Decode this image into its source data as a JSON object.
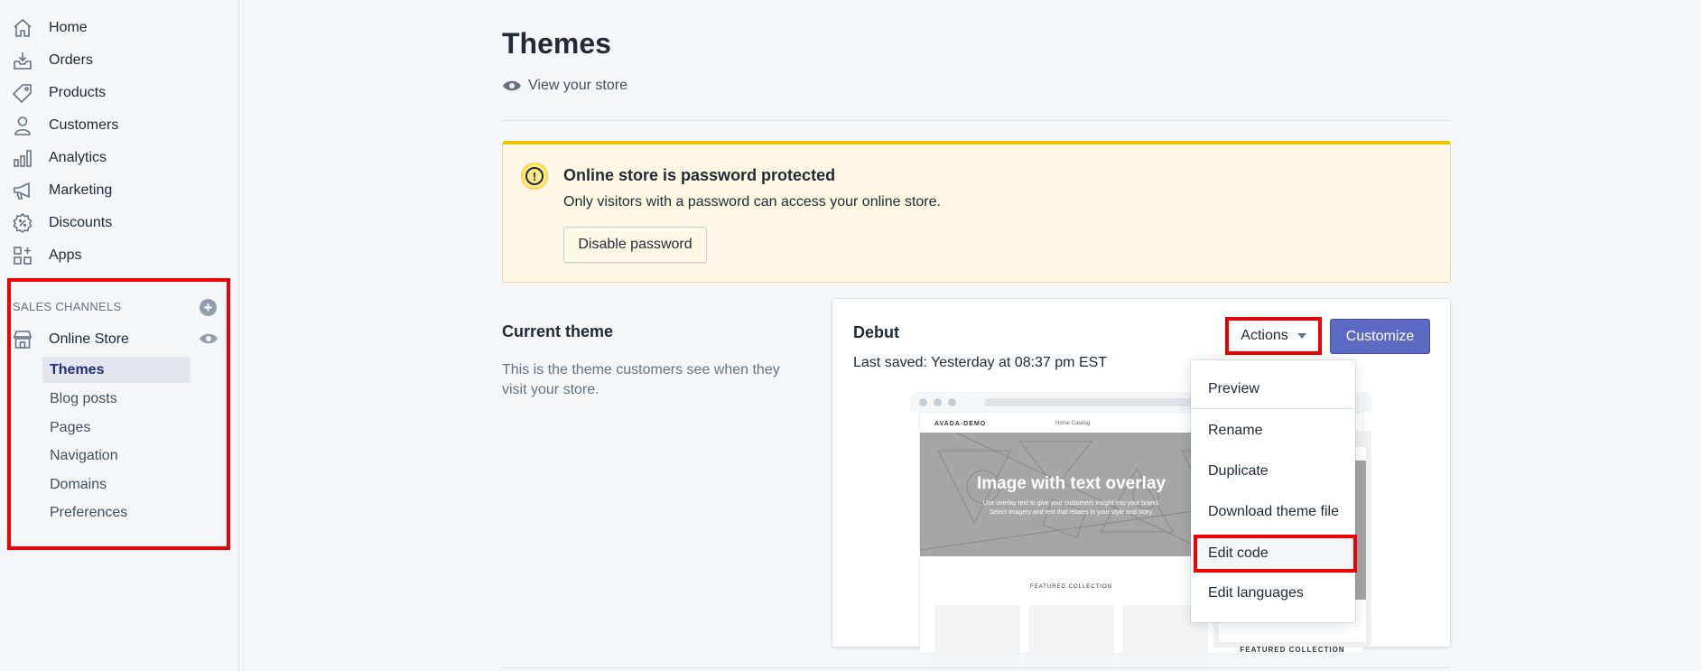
{
  "sidebar": {
    "items": [
      {
        "label": "Home",
        "icon": "home-icon"
      },
      {
        "label": "Orders",
        "icon": "orders-icon"
      },
      {
        "label": "Products",
        "icon": "tag-icon"
      },
      {
        "label": "Customers",
        "icon": "person-icon"
      },
      {
        "label": "Analytics",
        "icon": "bar-chart-icon"
      },
      {
        "label": "Marketing",
        "icon": "megaphone-icon"
      },
      {
        "label": "Discounts",
        "icon": "discount-icon"
      },
      {
        "label": "Apps",
        "icon": "apps-icon"
      }
    ],
    "sales_channels": {
      "title": "SALES CHANNELS",
      "add_symbol": "+",
      "online_store": {
        "label": "Online Store",
        "icon": "store-icon"
      },
      "sub_items": [
        "Themes",
        "Blog posts",
        "Pages",
        "Navigation",
        "Domains",
        "Preferences"
      ],
      "active": "Themes"
    }
  },
  "main": {
    "title": "Themes",
    "view_store": "View your store",
    "banner": {
      "title": "Online store is password protected",
      "text": "Only visitors with a password can access your online store.",
      "button": "Disable password",
      "icon_symbol": "!"
    },
    "current_theme": {
      "title": "Current theme",
      "description": "This is the theme customers see when they visit your store."
    },
    "theme": {
      "name": "Debut",
      "last_saved": "Last saved: Yesterday at 08:37 pm EST",
      "actions_label": "Actions",
      "customize_label": "Customize",
      "preview": {
        "logo": "AVADA-DEMO",
        "links": "Home   Catalog",
        "hero_title": "Image with text overlay",
        "hero_sub_1": "Use overlay text to give your customers insight into your brand.",
        "hero_sub_2": "Select imagery and text that relates to your style and story.",
        "featured": "FEATURED COLLECTION",
        "mobile_featured": "FEATURED COLLECTION"
      }
    },
    "actions_menu": [
      "Preview",
      "Rename",
      "Duplicate",
      "Download theme file",
      "Edit code",
      "Edit languages"
    ]
  },
  "colors": {
    "accent": "#5c6ac4",
    "highlight": "#ee0000",
    "banner_bg": "#fdf7e3",
    "banner_border": "#eec200"
  }
}
